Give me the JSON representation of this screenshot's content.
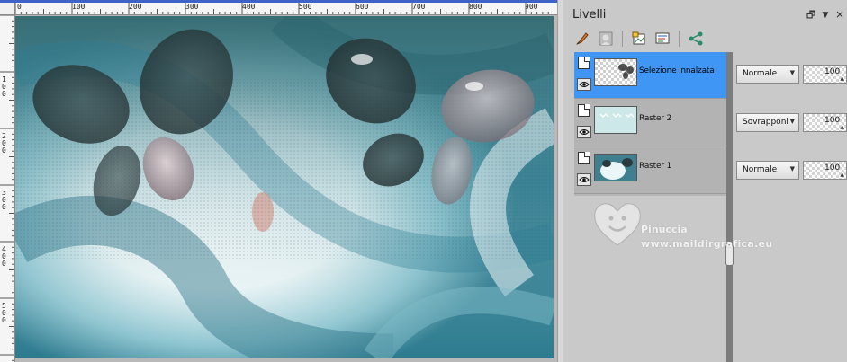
{
  "ruler": {
    "h_labels": [
      "0",
      "100",
      "200",
      "300",
      "400",
      "500",
      "600",
      "700",
      "800",
      "900"
    ],
    "v_labels": [
      "1 0 0",
      "2 0 0",
      "3 0 0",
      "4 0 0",
      "5 0 0"
    ]
  },
  "panel": {
    "title": "Livelli",
    "dock_glyph": "🗗",
    "menu_glyph": "▼",
    "close_glyph": "×"
  },
  "toolbar": {
    "icons": [
      "paint-brush-icon",
      "mask-icon",
      "new-raster-layer-icon",
      "properties-icon",
      "share-icon"
    ]
  },
  "layers": [
    {
      "name": "Selezione innalzata",
      "blend_mode": "Normale",
      "opacity": "100",
      "selected": true
    },
    {
      "name": "Raster 2",
      "blend_mode": "Sovrapponi",
      "opacity": "100",
      "selected": false
    },
    {
      "name": "Raster 1",
      "blend_mode": "Normale",
      "opacity": "100",
      "selected": false
    }
  ],
  "watermark": {
    "name": "Pinuccia",
    "site": "www.maildirgrafica.eu"
  },
  "colors": {
    "selection": "#3f96f5",
    "canvas_teal": "#2f7f95",
    "butterfly_dark": "#2b3b3d",
    "ruler_strip": "#3d63c9"
  }
}
